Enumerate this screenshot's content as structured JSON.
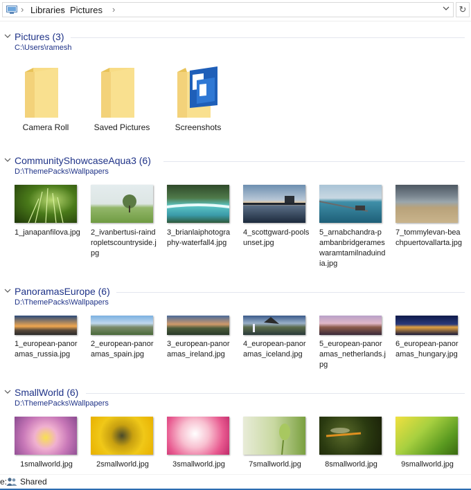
{
  "breadcrumb": [
    "Libraries",
    "Pictures"
  ],
  "groups": [
    {
      "title": "Pictures (3)",
      "path": "C:\\Users\\ramesh",
      "items": [
        {
          "name": "Camera Roll",
          "icon": "folder-icon"
        },
        {
          "name": "Saved Pictures",
          "icon": "folder-icon"
        },
        {
          "name": "Screenshots",
          "icon": "folder-with-screenshots-icon"
        }
      ]
    },
    {
      "title": "CommunityShowcaseAqua3 (6)",
      "path": "D:\\ThemePacks\\Wallpapers",
      "items": [
        {
          "name": "1_janapanfilova.jpg",
          "thumb": "green-plant-closeup"
        },
        {
          "name": "2_ivanbertusi-raindropletscountryside.jpg",
          "thumb": "tree-in-field"
        },
        {
          "name": "3_brianlaiphotography-waterfall4.jpg",
          "thumb": "turquoise-waterfall"
        },
        {
          "name": "4_scottgward-poolsunset.jpg",
          "thumb": "pool-sunset"
        },
        {
          "name": "5_arnabchandra-pambanbridgerameswaramtamilnaduindia.jpg",
          "thumb": "sea-bridge"
        },
        {
          "name": "7_tommylevan-beachpuertovallarta.jpg",
          "thumb": "beach-storm"
        }
      ]
    },
    {
      "title": "PanoramasEurope (6)",
      "path": "D:\\ThemePacks\\Wallpapers",
      "items": [
        {
          "name": "1_european-panoramas_russia.jpg",
          "thumb": "russia-sunset"
        },
        {
          "name": "2_european-panoramas_spain.jpg",
          "thumb": "spain-mountains"
        },
        {
          "name": "3_european-panoramas_ireland.jpg",
          "thumb": "ireland-coast"
        },
        {
          "name": "4_european-panoramas_iceland.jpg",
          "thumb": "iceland-waterfall"
        },
        {
          "name": "5_european-panoramas_netherlands.jpg",
          "thumb": "netherlands-dusk"
        },
        {
          "name": "6_european-panoramas_hungary.jpg",
          "thumb": "hungary-night"
        }
      ]
    },
    {
      "title": "SmallWorld (6)",
      "path": "D:\\ThemePacks\\Wallpapers",
      "items": [
        {
          "name": "1smallworld.jpg",
          "thumb": "lily-flower"
        },
        {
          "name": "2smallworld.jpg",
          "thumb": "bee-on-flower"
        },
        {
          "name": "3smallworld.jpg",
          "thumb": "pink-petals"
        },
        {
          "name": "7smallworld.jpg",
          "thumb": "green-bud"
        },
        {
          "name": "8smallworld.jpg",
          "thumb": "dragonfly"
        },
        {
          "name": "9smallworld.jpg",
          "thumb": "leaf-droplets"
        }
      ]
    }
  ],
  "status": {
    "prefix": "e:",
    "shared": "Shared"
  },
  "colors": {
    "group_title": "#1e3287",
    "accent": "#2b6cb0",
    "folder": "#f7d774"
  }
}
